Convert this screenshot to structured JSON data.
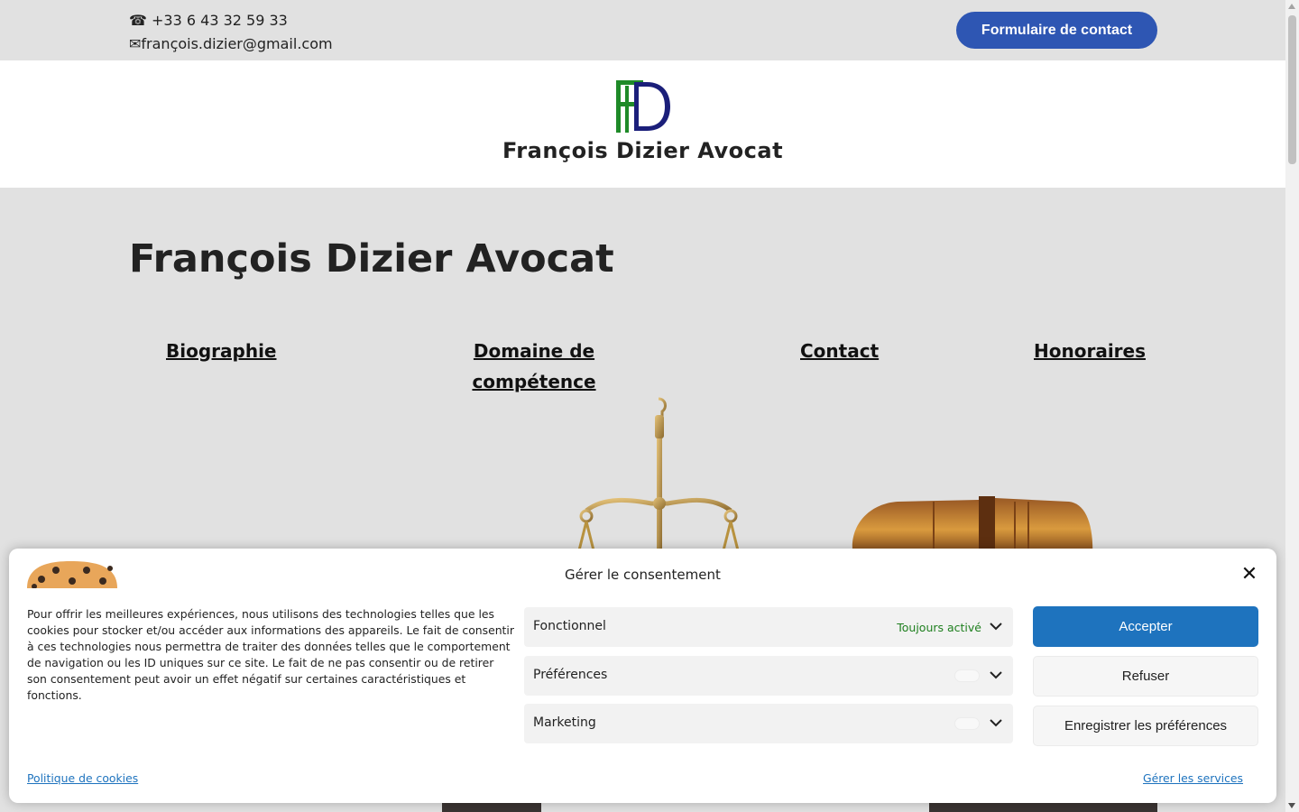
{
  "topbar": {
    "phone": "☎ +33 6 43 32 59 33",
    "email": "✉françois.dizier@gmail.com",
    "contact_button": "Formulaire de contact"
  },
  "header": {
    "logo_letters": "FD",
    "site_title": "François Dizier Avocat"
  },
  "hero": {
    "title": "François Dizier Avocat",
    "nav": [
      "Biographie",
      "Domaine de compétence",
      "Contact",
      "Honoraires"
    ]
  },
  "images": {
    "scale": "balance-scale-image",
    "gavel": "gavel-image"
  },
  "colors": {
    "topbar_bg": "#e1e1e1",
    "button_blue": "#2e56b3",
    "accept_blue": "#1e73be",
    "logo_green": "#1e8a28",
    "logo_navy": "#1b1f7a",
    "always_active_green": "#1e7f1e"
  },
  "cookie": {
    "title": "Gérer le consentement",
    "text": "Pour offrir les meilleures expériences, nous utilisons des technologies telles que les cookies pour stocker et/ou accéder aux informations des appareils. Le fait de consentir à ces technologies nous permettra de traiter des données telles que le comportement de navigation ou les ID uniques sur ce site. Le fait de ne pas consentir ou de retirer son consentement peut avoir un effet négatif sur certaines caractéristiques et fonctions.",
    "categories": [
      {
        "label": "Fonctionnel",
        "status": "Toujours activé"
      },
      {
        "label": "Préférences",
        "status": ""
      },
      {
        "label": "Marketing",
        "status": ""
      }
    ],
    "accept": "Accepter",
    "refuse": "Refuser",
    "save": "Enregistrer les préférences",
    "policy_link": "Politique de cookies",
    "manage_link": "Gérer les services"
  }
}
